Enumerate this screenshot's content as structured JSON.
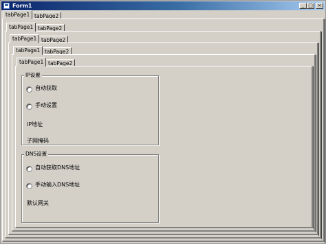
{
  "window": {
    "title": "Form1",
    "minimize_glyph": "_",
    "maximize_glyph": "□",
    "close_glyph": "×"
  },
  "tabs": [
    {
      "page1": "tabPage1",
      "page2": "tabPage2"
    },
    {
      "page1": "tabPage1",
      "page2": "tabPage2"
    },
    {
      "page1": "tabPage1",
      "page2": "tabPage2"
    },
    {
      "page1": "tabPage1",
      "page2": "tabPage2"
    },
    {
      "page1": "tabPage1",
      "page2": "tabPage2"
    }
  ],
  "ip_group": {
    "legend": "IP设置",
    "auto_label": "自动获取",
    "manual_label": "手动设置",
    "ip_label": "IP地址",
    "mask_label": "子网掩码"
  },
  "dns_group": {
    "legend": "DNS设置",
    "auto_label": "自动获取DNS地址",
    "manual_label": "手动输入DNS地址",
    "gateway_label": "默认网关"
  }
}
